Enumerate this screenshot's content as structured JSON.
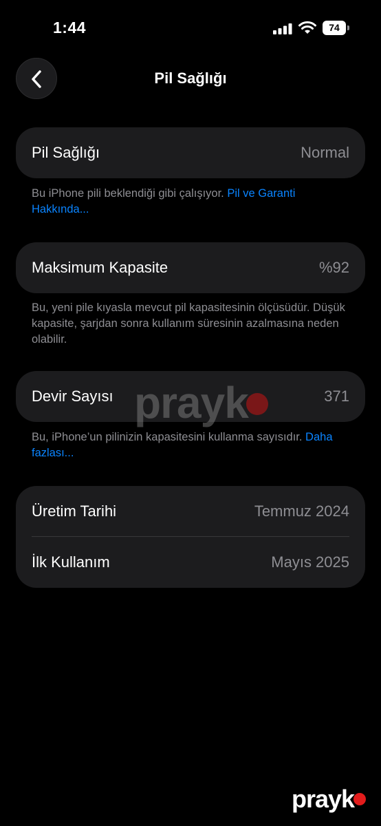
{
  "status_bar": {
    "time": "1:44",
    "battery_percent": "74"
  },
  "header": {
    "title": "Pil Sağlığı",
    "back_icon": "chevron-left-icon"
  },
  "battery_health": {
    "label": "Pil Sağlığı",
    "value": "Normal",
    "footnote_text": "Bu iPhone pili beklendiği gibi çalışıyor. ",
    "footnote_link": "Pil ve Garanti Hakkında..."
  },
  "max_capacity": {
    "label": "Maksimum Kapasite",
    "value": "%92",
    "footnote_text": "Bu, yeni pile kıyasla mevcut pil kapasitesinin ölçüsüdür. Düşük kapasite, şarjdan sonra kullanım süresinin azalmasına neden olabilir."
  },
  "cycle_count": {
    "label": "Devir Sayısı",
    "value": "371",
    "footnote_text": "Bu, iPhone’un pilinizin kapasitesini kullanma sayısıdır. ",
    "footnote_link": "Daha fazlası..."
  },
  "dates": {
    "manufacture_label": "Üretim Tarihi",
    "manufacture_value": "Temmuz 2024",
    "first_use_label": "İlk Kullanım",
    "first_use_value": "Mayıs 2025"
  },
  "watermark": {
    "text": "prayk"
  },
  "corner_logo": {
    "text": "prayk"
  },
  "colors": {
    "background": "#000000",
    "card": "#1c1c1e",
    "link": "#0a84ff",
    "secondary_text": "#8e8e93",
    "brand_dot": "#e21c1c"
  }
}
